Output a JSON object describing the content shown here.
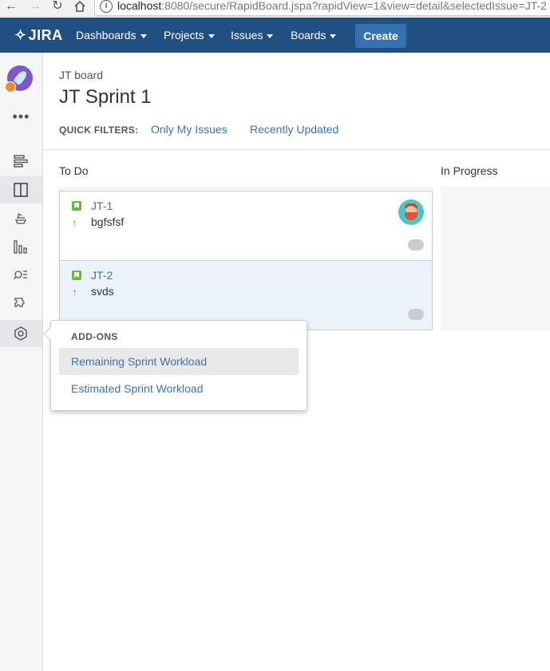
{
  "browser": {
    "url_host": "localhost",
    "url_path": ":8080/secure/RapidBoard.jspa?rapidView=1&view=detail&selectedIssue=JT-2",
    "info_icon": "info-icon"
  },
  "header": {
    "logo": "JIRA",
    "nav": [
      {
        "label": "Dashboards"
      },
      {
        "label": "Projects"
      },
      {
        "label": "Issues"
      },
      {
        "label": "Boards"
      }
    ],
    "create_label": "Create",
    "bg_color": "#205081"
  },
  "sidebar": {
    "more": "•••",
    "icons": [
      "backlog-icon",
      "active-sprints-icon",
      "releases-icon",
      "reports-icon",
      "issues-search-icon",
      "components-icon",
      "addons-icon"
    ]
  },
  "main": {
    "breadcrumb": "JT board",
    "title": "JT Sprint 1",
    "quick_filters_label": "QUICK FILTERS:",
    "quick_filters": [
      "Only My Issues",
      "Recently Updated"
    ]
  },
  "columns": [
    {
      "name": "To Do"
    },
    {
      "name": "In Progress"
    }
  ],
  "cards": [
    {
      "key": "JT-1",
      "summary": "bgfsfsf",
      "selected": false
    },
    {
      "key": "JT-2",
      "summary": "svds",
      "selected": true
    }
  ],
  "addons_menu": {
    "heading": "ADD-ONS",
    "items": [
      "Remaining Sprint Workload",
      "Estimated Sprint Workload"
    ]
  }
}
